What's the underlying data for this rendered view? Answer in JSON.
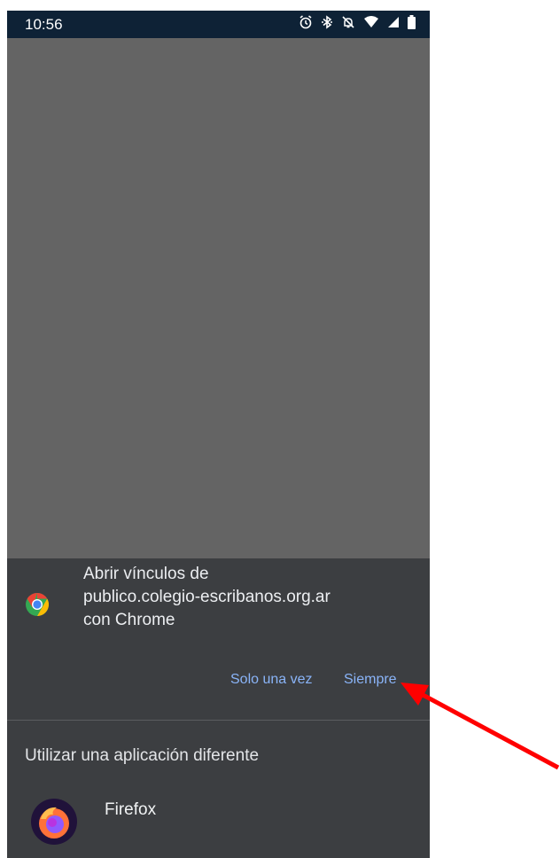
{
  "status_bar": {
    "time": "10:56",
    "icons": [
      "alarm-icon",
      "bluetooth-icon",
      "mute-icon",
      "wifi-icon",
      "signal-icon",
      "battery-icon"
    ]
  },
  "dialog": {
    "title_lines": [
      "Abrir vínculos de",
      "publico.colegio-escribanos.org.ar",
      "con Chrome"
    ],
    "app_icon": "chrome-icon",
    "button_once": "Solo una vez",
    "button_always": "Siempre",
    "accent_color": "#8ab4f8"
  },
  "alternatives": {
    "heading": "Utilizar una aplicación diferente",
    "apps": [
      {
        "label": "Firefox",
        "icon": "firefox-icon"
      }
    ]
  },
  "annotation": {
    "type": "arrow",
    "color": "#ff0000",
    "points_to": "Siempre"
  }
}
